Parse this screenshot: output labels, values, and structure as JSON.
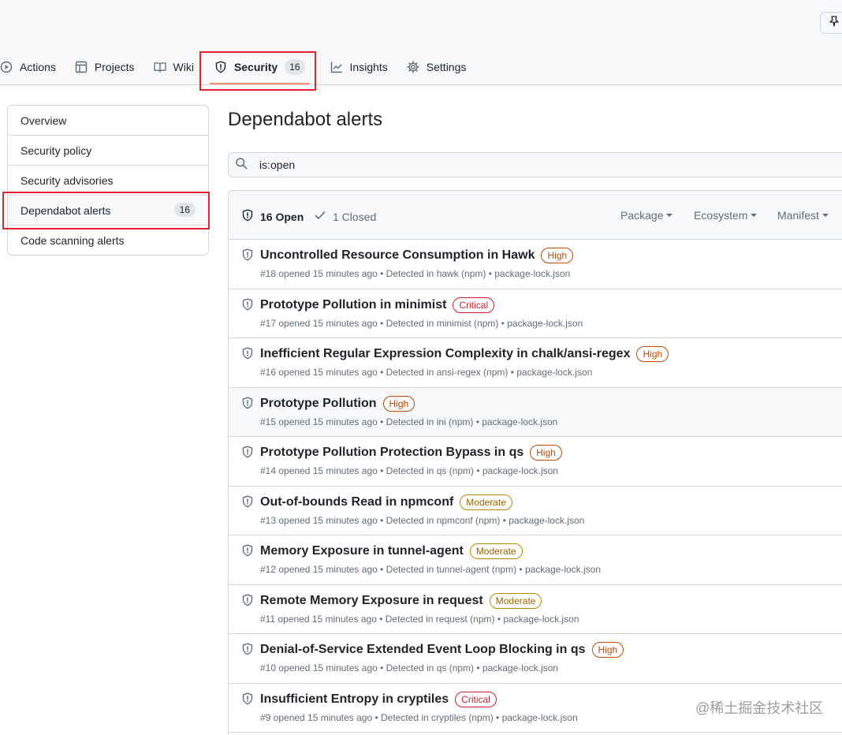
{
  "nav": {
    "actions": "Actions",
    "projects": "Projects",
    "wiki": "Wiki",
    "security": "Security",
    "security_count": "16",
    "insights": "Insights",
    "settings": "Settings"
  },
  "sidebar": {
    "items": [
      {
        "label": "Overview"
      },
      {
        "label": "Security policy"
      },
      {
        "label": "Security advisories"
      },
      {
        "label": "Dependabot alerts",
        "count": "16"
      },
      {
        "label": "Code scanning alerts"
      }
    ]
  },
  "main": {
    "title": "Dependabot alerts",
    "search_value": "is:open"
  },
  "list": {
    "open_label": "16 Open",
    "closed_label": "1 Closed",
    "filters": [
      "Package",
      "Ecosystem",
      "Manifest"
    ],
    "alerts": [
      {
        "title": "Uncontrolled Resource Consumption in Hawk",
        "severity": "High",
        "meta": "#18 opened 15 minutes ago • Detected in hawk (npm) • package-lock.json"
      },
      {
        "title": "Prototype Pollution in minimist",
        "severity": "Critical",
        "meta": "#17 opened 15 minutes ago • Detected in minimist (npm) • package-lock.json"
      },
      {
        "title": "Inefficient Regular Expression Complexity in chalk/ansi-regex",
        "severity": "High",
        "meta": "#16 opened 15 minutes ago • Detected in ansi-regex (npm) • package-lock.json"
      },
      {
        "title": "Prototype Pollution",
        "severity": "High",
        "meta": "#15 opened 15 minutes ago • Detected in ini (npm) • package-lock.json"
      },
      {
        "title": "Prototype Pollution Protection Bypass in qs",
        "severity": "High",
        "meta": "#14 opened 15 minutes ago • Detected in qs (npm) • package-lock.json"
      },
      {
        "title": "Out-of-bounds Read in npmconf",
        "severity": "Moderate",
        "meta": "#13 opened 15 minutes ago • Detected in npmconf (npm) • package-lock.json"
      },
      {
        "title": "Memory Exposure in tunnel-agent",
        "severity": "Moderate",
        "meta": "#12 opened 15 minutes ago • Detected in tunnel-agent (npm) • package-lock.json"
      },
      {
        "title": "Remote Memory Exposure in request",
        "severity": "Moderate",
        "meta": "#11 opened 15 minutes ago • Detected in request (npm) • package-lock.json"
      },
      {
        "title": "Denial-of-Service Extended Event Loop Blocking in qs",
        "severity": "High",
        "meta": "#10 opened 15 minutes ago • Detected in qs (npm) • package-lock.json"
      },
      {
        "title": "Insufficient Entropy in cryptiles",
        "severity": "Critical",
        "meta": "#9 opened 15 minutes ago • Detected in cryptiles (npm) • package-lock.json"
      }
    ]
  },
  "watermark": "@稀土掘金技术社区",
  "colors": {
    "accent_underline": "#fd8c73",
    "highlight_box": "#e0262c",
    "high": "#bc4c00",
    "critical": "#cf222e",
    "moderate": "#9a6700"
  },
  "icons": [
    "pin-icon",
    "play-icon",
    "table-icon",
    "book-icon",
    "shield-icon",
    "graph-icon",
    "gear-icon",
    "search-icon",
    "check-icon"
  ]
}
